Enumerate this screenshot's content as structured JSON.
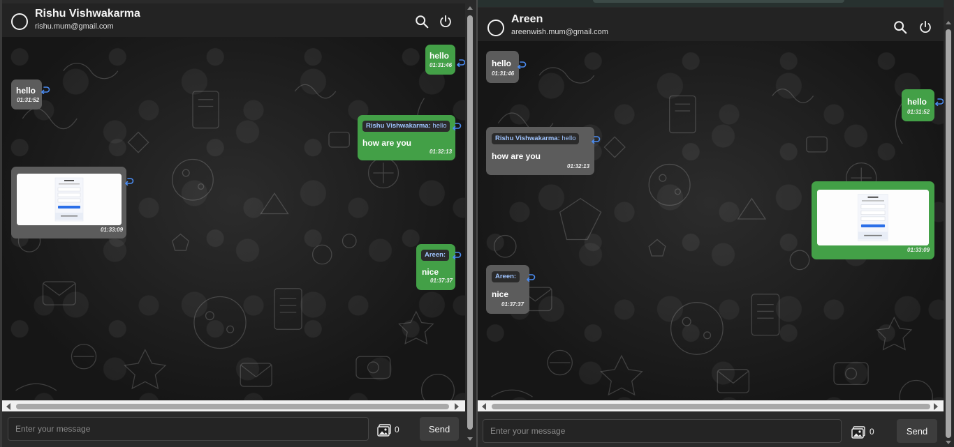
{
  "left": {
    "header": {
      "name": "Rishu Vishwakarma",
      "email": "rishu.mum@gmail.com"
    },
    "messages": [
      {
        "text": "hello",
        "time": "01:31:46"
      },
      {
        "text": "hello",
        "time": "01:31:52"
      },
      {
        "quote_name": "Rishu Vishwakarma:",
        "quote_text": "hello",
        "text": "how are you",
        "time": "01:32:13"
      },
      {
        "time": "01:33:09"
      },
      {
        "quote_name": "Areen:",
        "quote_text": "",
        "text": "nice",
        "time": "01:37:37"
      }
    ],
    "composer": {
      "placeholder": "Enter your message",
      "image_count": "0",
      "send_label": "Send"
    }
  },
  "right": {
    "header": {
      "name": "Areen",
      "email": "areenwish.mum@gmail.com"
    },
    "messages": [
      {
        "text": "hello",
        "time": "01:31:46"
      },
      {
        "text": "hello",
        "time": "01:31:52"
      },
      {
        "quote_name": "Rishu Vishwakarma:",
        "quote_text": "hello",
        "text": "how are you",
        "time": "01:32:13"
      },
      {
        "time": "01:33:09"
      },
      {
        "quote_name": "Areen:",
        "quote_text": "",
        "text": "nice",
        "time": "01:37:37"
      }
    ],
    "composer": {
      "placeholder": "Enter your message",
      "image_count": "0",
      "send_label": "Send"
    }
  },
  "colors": {
    "sent_bubble": "#43a047",
    "received_bubble": "#5c5c5c",
    "quote_name": "#9fc4ff"
  },
  "icons": [
    "search-icon",
    "power-icon",
    "reply-icon",
    "image-icon"
  ]
}
